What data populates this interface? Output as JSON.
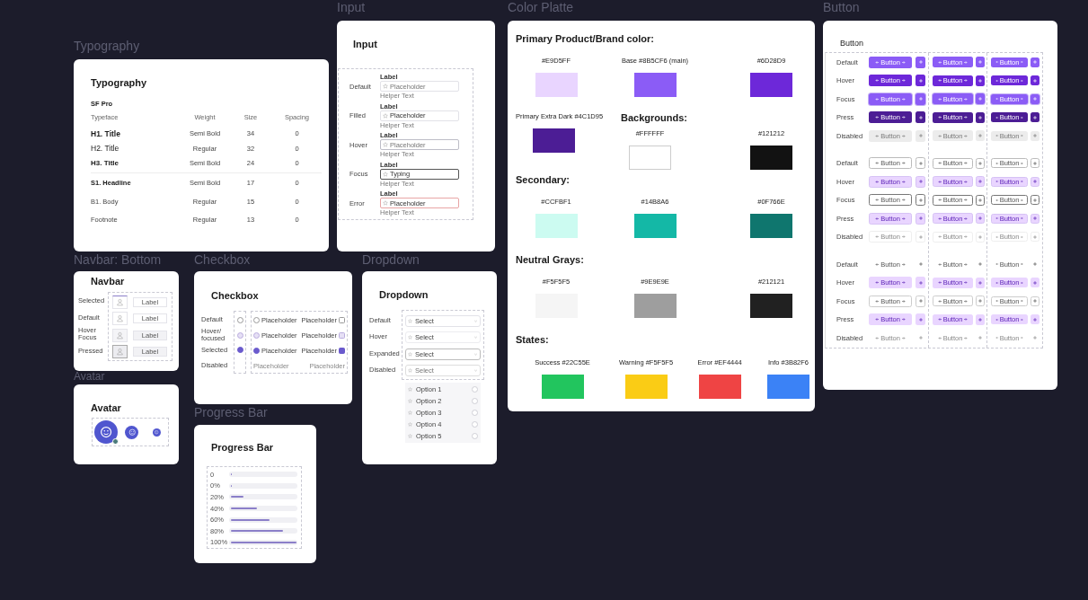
{
  "typography": {
    "frame_label": "Typography",
    "title": "Typography",
    "font": "SF Pro",
    "columns": [
      "Typeface",
      "Weight",
      "Size",
      "Spacing"
    ],
    "rows": [
      {
        "kind": "h1",
        "cells": [
          "H1. Title",
          "Semi Bold",
          "34",
          "0"
        ]
      },
      {
        "kind": "h2",
        "cells": [
          "H2. Title",
          "Regular",
          "32",
          "0"
        ]
      },
      {
        "kind": "h3",
        "cells": [
          "H3. Title",
          "Semi Bold",
          "24",
          "0"
        ]
      },
      {
        "kind": "s1",
        "cells": [
          "S1. Headline",
          "Semi Bold",
          "17",
          "0"
        ]
      },
      {
        "kind": "b1",
        "cells": [
          "B1. Body",
          "Regular",
          "15",
          "0"
        ]
      },
      {
        "kind": "footnote",
        "cells": [
          "Footnote",
          "Regular",
          "13",
          "0"
        ]
      }
    ]
  },
  "input": {
    "frame_label": "Input",
    "title": "Input",
    "rows": [
      {
        "kind": "default",
        "state": "Default",
        "label": "Label",
        "placeholder": "Placeholder",
        "helper": "Helper Text"
      },
      {
        "kind": "filled",
        "state": "Filled",
        "label": "Label",
        "value": "Placeholder",
        "helper": "Helper Text"
      },
      {
        "kind": "hover",
        "state": "Hover",
        "label": "Label",
        "placeholder": "Placeholder",
        "helper": "Helper Text"
      },
      {
        "kind": "focus",
        "state": "Focus",
        "label": "Label",
        "value": "Typing",
        "helper": "Helper Text"
      },
      {
        "kind": "error",
        "state": "Error",
        "label": "Label",
        "value": "Placeholder",
        "helper": "Helper Text"
      }
    ]
  },
  "color_palette": {
    "frame_label": "Color Platte",
    "blocks": [
      {
        "kind": "heading",
        "text": "Primary Product/Brand color:"
      },
      {
        "kind": "swatches",
        "items": [
          {
            "label": "#E9D5FF",
            "color": "#e9d5ff"
          },
          {
            "label": "Base #8B5CF6 (main)",
            "color": "#8b5cf6"
          },
          {
            "label": "#6D28D9",
            "color": "#6d28d9"
          }
        ]
      },
      {
        "kind": "split",
        "left": {
          "label": "Primary Extra Dark  #4C1D95",
          "color": "#4c1d95"
        },
        "heading": "Backgrounds:",
        "right": [
          {
            "label": "#FFFFFF",
            "color": "#ffffff"
          },
          {
            "label": "#121212",
            "color": "#121212"
          }
        ]
      },
      {
        "kind": "heading",
        "text": "Secondary:"
      },
      {
        "kind": "swatches",
        "items": [
          {
            "label": "#CCFBF1",
            "color": "#ccfbf1"
          },
          {
            "label": "#14B8A6",
            "color": "#14b8a6"
          },
          {
            "label": "#0F766E",
            "color": "#0f766e"
          }
        ]
      },
      {
        "kind": "heading",
        "text": "Neutral Grays:"
      },
      {
        "kind": "swatches",
        "items": [
          {
            "label": "#F5F5F5",
            "color": "#f5f5f5"
          },
          {
            "label": "#9E9E9E",
            "color": "#9e9e9e"
          },
          {
            "label": "#212121",
            "color": "#212121"
          }
        ]
      },
      {
        "kind": "heading",
        "text": "States:"
      },
      {
        "kind": "states",
        "items": [
          {
            "label": "Success #22C55E",
            "color": "#22c55e"
          },
          {
            "label": "Warning #F5F5F5",
            "color": "#facc15"
          },
          {
            "label": "Error #EF4444",
            "color": "#ef4444"
          },
          {
            "label": "Info #3B82F6",
            "color": "#3b82f6"
          }
        ]
      }
    ]
  },
  "button": {
    "frame_label": "Button",
    "title": "Button",
    "groups": [
      {
        "kind": "filled",
        "rows": [
          {
            "kind": "default",
            "state": "Default",
            "buttons": [
              "Button",
              "Button",
              "Button"
            ]
          },
          {
            "kind": "hover",
            "state": "Hover",
            "buttons": [
              "Button",
              "Button",
              "Button"
            ]
          },
          {
            "kind": "focus",
            "state": "Focus",
            "buttons": [
              "Button",
              "Button",
              "Button"
            ]
          },
          {
            "kind": "press",
            "state": "Press",
            "buttons": [
              "Button",
              "Button",
              "Button"
            ]
          },
          {
            "kind": "disabled",
            "state": "Disabled",
            "buttons": [
              "Button",
              "Button",
              "Button"
            ]
          }
        ]
      },
      {
        "kind": "outline",
        "rows": [
          {
            "kind": "default",
            "state": "Default",
            "buttons": [
              "Button",
              "Button",
              "Button"
            ]
          },
          {
            "kind": "hover",
            "state": "Hover",
            "buttons": [
              "Button",
              "Button",
              "Button"
            ]
          },
          {
            "kind": "focus",
            "state": "Focus",
            "buttons": [
              "Button",
              "Button",
              "Button"
            ]
          },
          {
            "kind": "press",
            "state": "Press",
            "buttons": [
              "Button",
              "Button",
              "Button"
            ]
          },
          {
            "kind": "disabled",
            "state": "Disabled",
            "buttons": [
              "Button",
              "Button",
              "Button"
            ]
          }
        ]
      },
      {
        "kind": "ghost",
        "rows": [
          {
            "kind": "default",
            "state": "Default",
            "buttons": [
              "Button",
              "Button",
              "Button"
            ]
          },
          {
            "kind": "hover",
            "state": "Hover",
            "buttons": [
              "Button",
              "Button",
              "Button"
            ]
          },
          {
            "kind": "focus",
            "state": "Focus",
            "buttons": [
              "Button",
              "Button",
              "Button"
            ]
          },
          {
            "kind": "press",
            "state": "Press",
            "buttons": [
              "Button",
              "Button",
              "Button"
            ]
          },
          {
            "kind": "disabled",
            "state": "Disabled",
            "buttons": [
              "Button",
              "Button",
              "Button"
            ]
          }
        ]
      }
    ]
  },
  "navbar": {
    "frame_label": "Navbar: Bottom",
    "title": "Navbar",
    "rows": [
      {
        "kind": "selected",
        "state": "Selected",
        "tab_label": "Label"
      },
      {
        "kind": "default",
        "state": "Default",
        "tab_label": "Label"
      },
      {
        "kind": "hover",
        "state": "Hover Focus",
        "tab_label": "Label"
      },
      {
        "kind": "pressed",
        "state": "Pressed",
        "tab_label": "Label"
      }
    ]
  },
  "checkbox": {
    "frame_label": "Checkbox",
    "title": "Checkbox",
    "rows": [
      {
        "kind": "default",
        "state": "Default",
        "checked": false,
        "options": [
          "Placeholder",
          "Placeholder"
        ]
      },
      {
        "kind": "hover",
        "state": "Hover/ focused",
        "checked": false,
        "options": [
          "Placeholder",
          "Placeholder"
        ]
      },
      {
        "kind": "selected",
        "state": "Selected",
        "checked": true,
        "options": [
          "Placeholder",
          "Placeholder"
        ]
      },
      {
        "kind": "disabled",
        "state": "Disabled",
        "checked": false,
        "options": [
          "Placeholder",
          "Placeholder"
        ]
      }
    ]
  },
  "dropdown": {
    "frame_label": "Dropdown",
    "title": "Dropdown",
    "rows": [
      {
        "kind": "default",
        "state": "Default",
        "value": "Select"
      },
      {
        "kind": "hover",
        "state": "Hover",
        "value": "Select"
      },
      {
        "kind": "expanded",
        "state": "Expanded",
        "value": "Select"
      },
      {
        "kind": "disabled",
        "state": "Disabled",
        "value": "Select"
      }
    ],
    "options": [
      {
        "label": "Option 1",
        "selected": false
      },
      {
        "label": "Option 2",
        "selected": false
      },
      {
        "label": "Option 3",
        "selected": false
      },
      {
        "label": "Option 4",
        "selected": false
      },
      {
        "label": "Option 5",
        "selected": false
      }
    ]
  },
  "avatar": {
    "frame_label": "Avatar",
    "title": "Avatar",
    "items": [
      {
        "kind": "large",
        "online": true
      },
      {
        "kind": "medium",
        "online": false
      },
      {
        "kind": "small",
        "online": false
      }
    ]
  },
  "progress_bar": {
    "frame_label": "Progress Bar",
    "title": "Progress Bar",
    "rows": [
      {
        "label": "0",
        "level": 0
      },
      {
        "label": "0%",
        "level": 0
      },
      {
        "label": "20%",
        "level": 0.2
      },
      {
        "label": "40%",
        "level": 0.4
      },
      {
        "label": "60%",
        "level": 0.6
      },
      {
        "label": "80%",
        "level": 0.8
      },
      {
        "label": "100%",
        "level": 1
      }
    ]
  }
}
